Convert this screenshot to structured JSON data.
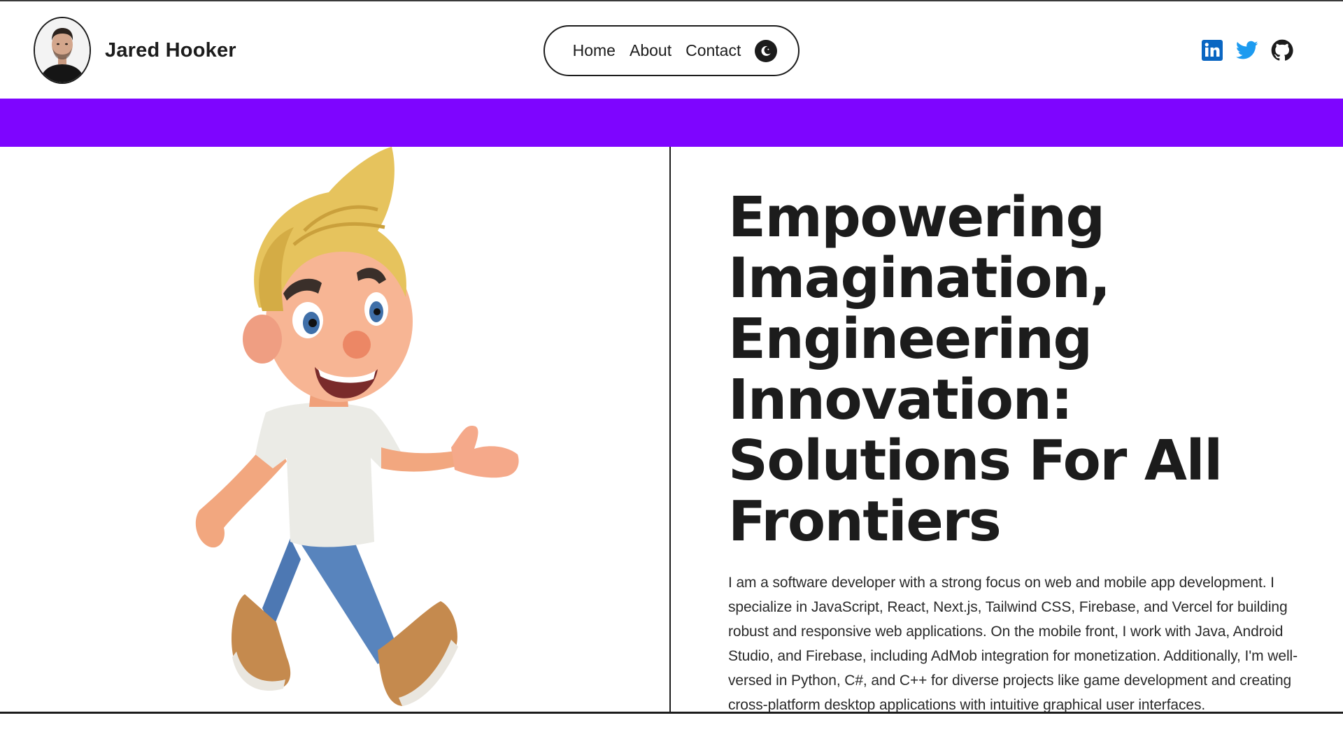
{
  "header": {
    "name": "Jared Hooker",
    "nav": [
      {
        "label": "Home"
      },
      {
        "label": "About"
      },
      {
        "label": "Contact"
      }
    ],
    "theme_toggle_icon": "moon-icon",
    "socials": [
      {
        "icon": "linkedin-icon",
        "color": "#0a66c2"
      },
      {
        "icon": "twitter-icon",
        "color": "#1d9bf0"
      },
      {
        "icon": "github-icon",
        "color": "#1c1c1c"
      }
    ]
  },
  "colors": {
    "accent_band": "#7e05ff",
    "text": "#1c1c1c",
    "background": "#ffffff"
  },
  "hero": {
    "headline": "Empowering Imagination, Engineering Innovation: Solutions For All Frontiers",
    "bio": "I am a software developer with a strong focus on web and mobile app development. I specialize in JavaScript, React, Next.js, Tailwind CSS, Firebase, and Vercel for building robust and responsive web applications. On the mobile front, I work with Java, Android Studio, and Firebase, including AdMob integration for monetization. Additionally, I'm well-versed in Python, C#, and C++ for diverse projects like game development and creating cross-platform desktop applications with intuitive graphical user interfaces."
  }
}
